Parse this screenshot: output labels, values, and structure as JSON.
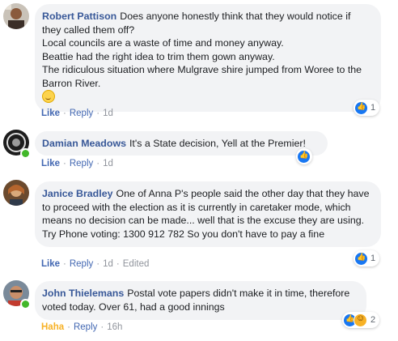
{
  "colors": {
    "name_link": "#385898",
    "action_link": "#4267b2",
    "meta_grey": "#90949c",
    "bubble_bg": "#f2f3f5",
    "haha_yellow": "#f7b125",
    "online_green": "#42b72a",
    "like_blue": "#1877f2"
  },
  "comments": [
    {
      "author": "Robert Pattison",
      "text": "Does anyone honestly think that they would notice if they called them off?\nLocal councils are a waste of time and money anyway.\nBeattie had the right idea to trim them gown anyway.\nThe ridiculous situation where Mulgrave shire jumped from Woree to the Barron River.",
      "emoji": "slight-smile-emoji",
      "actions": {
        "primary": "Like",
        "reply": "Reply",
        "time": "1d",
        "edited": ""
      },
      "reaction_count": "1",
      "reaction_icons": [
        "like-icon"
      ],
      "online": false
    },
    {
      "author": "Damian Meadows",
      "text": "It's a State decision, Yell at the Premier!",
      "actions": {
        "primary": "Like",
        "reply": "Reply",
        "time": "1d",
        "edited": ""
      },
      "reaction_count": "",
      "reaction_icons": [
        "like-icon"
      ],
      "online": true
    },
    {
      "author": "Janice Bradley",
      "text": "One of Anna P's people said the other day that they have to proceed with the election as it is currently in caretaker mode, which means no decision can be made... well that is the excuse they are using. Try Phone voting: 1300 912 782 So you don't have to pay a fine",
      "actions": {
        "primary": "Like",
        "reply": "Reply",
        "time": "1d",
        "edited": "Edited"
      },
      "reaction_count": "1",
      "reaction_icons": [
        "like-icon"
      ],
      "online": false
    },
    {
      "author": "John Thielemans",
      "text": "Postal vote papers didn't make it in time, therefore voted today. Over 61, had a good innings",
      "actions": {
        "primary": "Haha",
        "reply": "Reply",
        "time": "16h",
        "edited": ""
      },
      "reaction_count": "2",
      "reaction_icons": [
        "like-icon",
        "haha-icon"
      ],
      "online": true
    }
  ]
}
